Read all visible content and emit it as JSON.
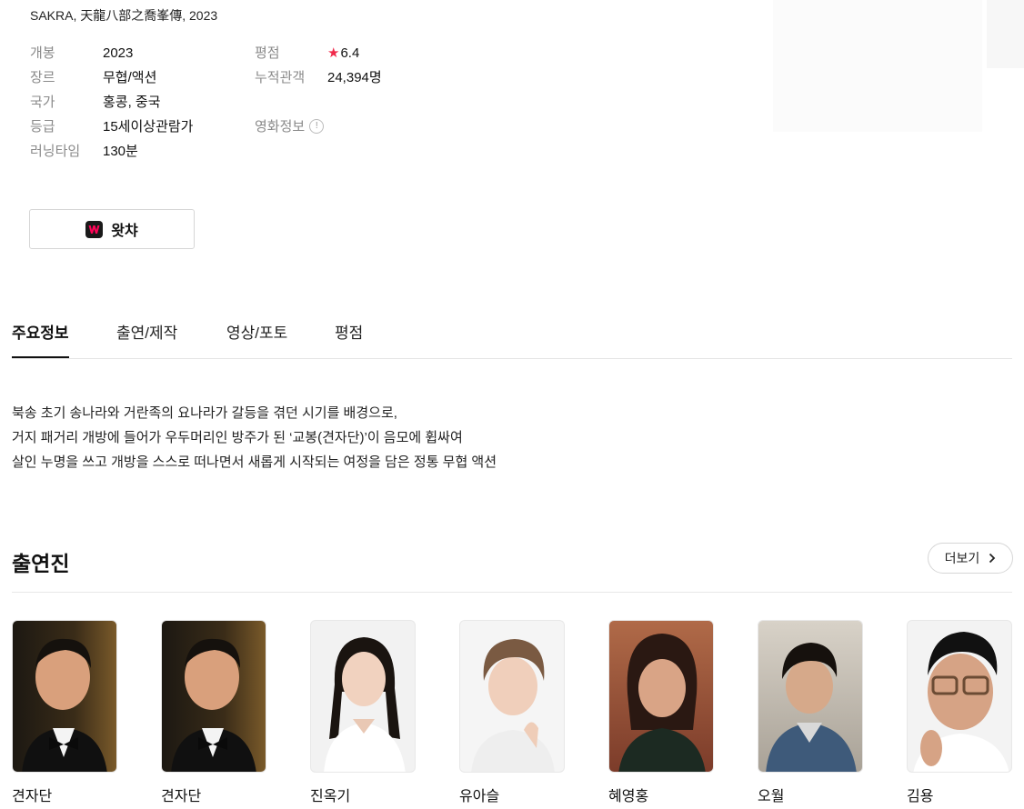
{
  "movie": {
    "original_title": "SAKRA, 天龍八部之喬峯傳, 2023"
  },
  "info": {
    "release_label": "개봉",
    "release_value": "2023",
    "genre_label": "장르",
    "genre_value": "무협/액션",
    "country_label": "국가",
    "country_value": "홍콩, 중국",
    "rating_label": "등급",
    "rating_value": "15세이상관람가",
    "runtime_label": "러닝타임",
    "runtime_value": "130분",
    "score_label": "평점",
    "score_value": "6.4",
    "audience_label": "누적관객",
    "audience_value": "24,394명",
    "movieinfo_label": "영화정보",
    "info_glyph": "!"
  },
  "watch": {
    "label": "왓챠",
    "icon": "watcha-logo-icon"
  },
  "tabs": [
    {
      "label": "주요정보",
      "active": true
    },
    {
      "label": "출연/제작",
      "active": false
    },
    {
      "label": "영상/포토",
      "active": false
    },
    {
      "label": "평점",
      "active": false
    }
  ],
  "synopsis": [
    "북송 초기 송나라와 거란족의 요나라가 갈등을 겪던 시기를 배경으로,",
    "거지 패거리 개방에 들어가 우두머리인 방주가 된 ‘교봉(견자단)’이 음모에 휩싸여",
    "살인 누명을 쓰고 개방을 스스로 떠나면서 새롭게 시작되는 여정을 담은 정통 무협 액션"
  ],
  "cast": {
    "title": "출연진",
    "more_label": "더보기",
    "members": [
      {
        "name": "견자단"
      },
      {
        "name": "견자단"
      },
      {
        "name": "진옥기"
      },
      {
        "name": "유아슬"
      },
      {
        "name": "혜영홍"
      },
      {
        "name": "오월"
      },
      {
        "name": "김용"
      }
    ]
  },
  "colors": {
    "accent_star": "#f02a4b",
    "watcha_brand": "#ff0558",
    "tab_active": "#111111"
  }
}
